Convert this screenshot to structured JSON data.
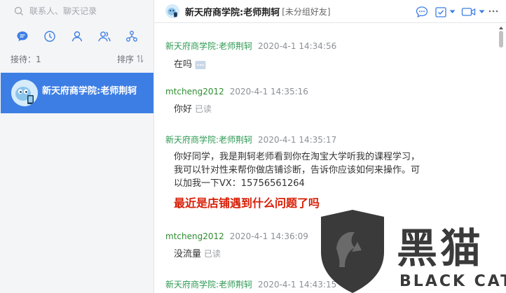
{
  "search": {
    "placeholder": "联系人、聊天记录"
  },
  "subbar": {
    "reception": "接待：1",
    "sort_label": "排序"
  },
  "contacts": [
    {
      "name": "新天府商学院:老师荆轲"
    }
  ],
  "header": {
    "title": "新天府商学院:老师荆轲",
    "group": "[未分组好友]"
  },
  "messages": [
    {
      "sender": "新天府商学院:老师荆轲",
      "time": "2020-4-1 14:34:56",
      "lines": [
        "在吗"
      ],
      "read": ""
    },
    {
      "sender": "mtcheng2012",
      "time": "2020-4-1 14:35:16",
      "lines": [
        "你好"
      ],
      "read": "已读"
    },
    {
      "sender": "新天府商学院:老师荆轲",
      "time": "2020-4-1 14:35:17",
      "lines": [
        "你好同学，我是荆轲老师看到你在淘宝大学听我的课程学习，",
        "我可以针对性来帮你做店铺诊断，告诉你应该如何来操作。可",
        "以加我一下VX：15756561264"
      ],
      "highlight": "最近是店铺遇到什么问题了吗",
      "read": ""
    },
    {
      "sender": "mtcheng2012",
      "time": "2020-4-1 14:36:09",
      "lines": [
        "没流量"
      ],
      "read": "已读"
    },
    {
      "sender": "新天府商学院:老师荆轲",
      "time": "2020-4-1 14:43:15",
      "lines": [],
      "read": ""
    }
  ],
  "watermark": {
    "cn": "黑猫",
    "en": "BLACK CAT"
  },
  "colors": {
    "accent": "#3d7ee4",
    "sender_teacher": "#2e9a53",
    "highlight": "#d81e06"
  },
  "icons": [
    "search-icon",
    "chat-tab-icon",
    "clock-icon",
    "person-icon",
    "group-icon",
    "org-icon",
    "sort-icon",
    "support-icon",
    "task-icon",
    "video-icon",
    "more-icon"
  ]
}
